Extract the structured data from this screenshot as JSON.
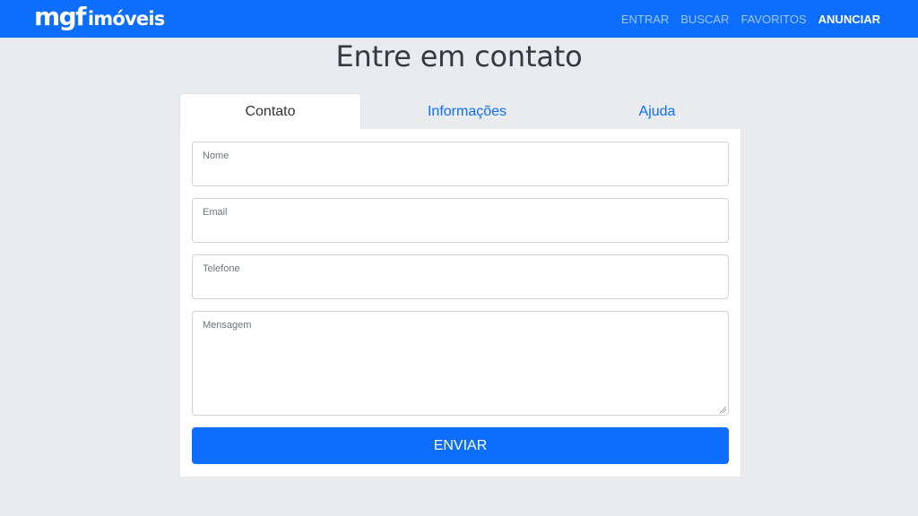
{
  "brand": {
    "logo_main": "mgf",
    "logo_sub": "imóveis"
  },
  "nav": {
    "items": [
      {
        "label": "ENTRAR",
        "active": false
      },
      {
        "label": "BUSCAR",
        "active": false
      },
      {
        "label": "FAVORITOS",
        "active": false
      },
      {
        "label": "ANUNCIAR",
        "active": true
      }
    ]
  },
  "page": {
    "title": "Entre em contato"
  },
  "tabs": [
    {
      "label": "Contato",
      "selected": true
    },
    {
      "label": "Informações",
      "selected": false
    },
    {
      "label": "Ajuda",
      "selected": false
    }
  ],
  "form": {
    "name": {
      "placeholder": "Nome",
      "value": ""
    },
    "email": {
      "placeholder": "Email",
      "value": ""
    },
    "phone": {
      "placeholder": "Telefone",
      "value": ""
    },
    "message": {
      "placeholder": "Mensagem",
      "value": ""
    },
    "submit_label": "ENVIAR"
  },
  "colors": {
    "primary": "#0d6efd",
    "background": "#e9ebee",
    "title_text": "#343a40"
  }
}
